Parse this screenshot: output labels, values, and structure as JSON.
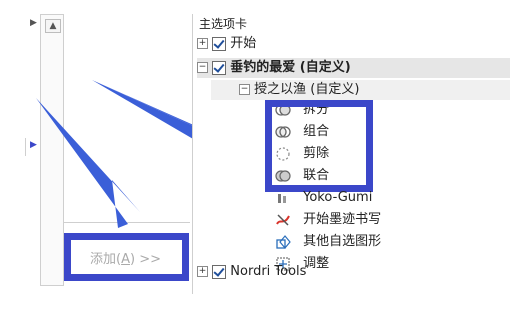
{
  "left_panel": {
    "add_button_label": "添加(A) >>",
    "add_button_main": "添加(",
    "add_button_key": "A",
    "add_button_tail": ") >>"
  },
  "tree": {
    "header": "主选项卡",
    "items": [
      {
        "label": "开始",
        "expander": "+",
        "checked": true
      },
      {
        "label": "垂钓的最爱 (自定义)",
        "expander": "−",
        "checked": true
      },
      {
        "label": "授之以渔 (自定义)",
        "expander": "−"
      },
      {
        "label": "拆分",
        "icon": "split-shapes-icon"
      },
      {
        "label": "组合",
        "icon": "combine-shapes-icon"
      },
      {
        "label": "剪除",
        "icon": "subtract-shapes-icon"
      },
      {
        "label": "联合",
        "icon": "union-shapes-icon"
      },
      {
        "label": "Yoko-Gumi",
        "icon": "yoko-gumi-icon"
      },
      {
        "label": "开始墨迹书写",
        "icon": "start-inking-icon"
      },
      {
        "label": "其他自选图形",
        "icon": "other-shapes-icon"
      },
      {
        "label": "调整",
        "icon": "adjust-icon"
      },
      {
        "label": "Nordri Tools",
        "expander": "+",
        "checked": true
      }
    ]
  },
  "colors": {
    "annotation_blue": "#3b47c9",
    "selection_gray": "#e6e6e6"
  }
}
